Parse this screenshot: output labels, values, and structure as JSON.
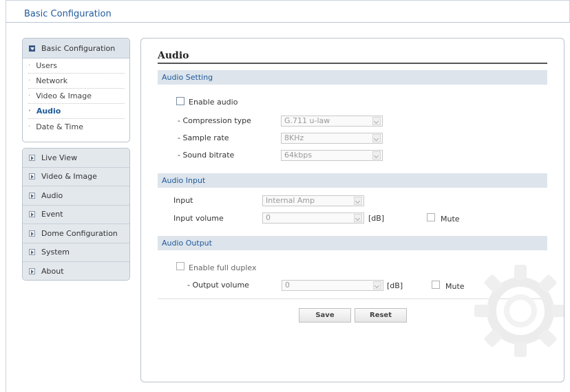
{
  "header": {
    "title": "Basic Configuration"
  },
  "sidebar": {
    "section_title": "Basic Configuration",
    "sub_items": [
      {
        "label": "Users",
        "active": false
      },
      {
        "label": "Network",
        "active": false
      },
      {
        "label": "Video & Image",
        "active": false
      },
      {
        "label": "Audio",
        "active": true
      },
      {
        "label": "Date & Time",
        "active": false
      }
    ],
    "nav_items": [
      {
        "label": "Live View"
      },
      {
        "label": "Video & Image"
      },
      {
        "label": "Audio"
      },
      {
        "label": "Event"
      },
      {
        "label": "Dome Configuration"
      },
      {
        "label": "System"
      },
      {
        "label": "About"
      }
    ]
  },
  "main": {
    "title": "Audio",
    "audio_setting": {
      "heading": "Audio Setting",
      "enable_label": "Enable audio",
      "enable_checked": false,
      "compression_label": "- Compression type",
      "compression_value": "G.711 u-law",
      "sample_rate_label": "- Sample rate",
      "sample_rate_value": "8KHz",
      "bitrate_label": "- Sound bitrate",
      "bitrate_value": "64kbps"
    },
    "audio_input": {
      "heading": "Audio Input",
      "input_label": "Input",
      "input_value": "Internal Amp",
      "volume_label": "Input volume",
      "volume_value": "0",
      "unit": "[dB]",
      "mute_label": "Mute",
      "mute_checked": false
    },
    "audio_output": {
      "heading": "Audio Output",
      "duplex_label": "Enable full duplex",
      "duplex_checked": false,
      "volume_label": "- Output volume",
      "volume_value": "0",
      "unit": "[dB]",
      "mute_label": "Mute",
      "mute_checked": false
    },
    "buttons": {
      "save": "Save",
      "reset": "Reset"
    }
  },
  "icons": {
    "section_open": "chevron-down-icon",
    "section_closed": "chevron-right-icon",
    "decoration": "gear-icon"
  },
  "colors": {
    "accent": "#1e5a9a",
    "section_bar": "#dde4ec",
    "nav_bg": "#e3e8ed"
  }
}
